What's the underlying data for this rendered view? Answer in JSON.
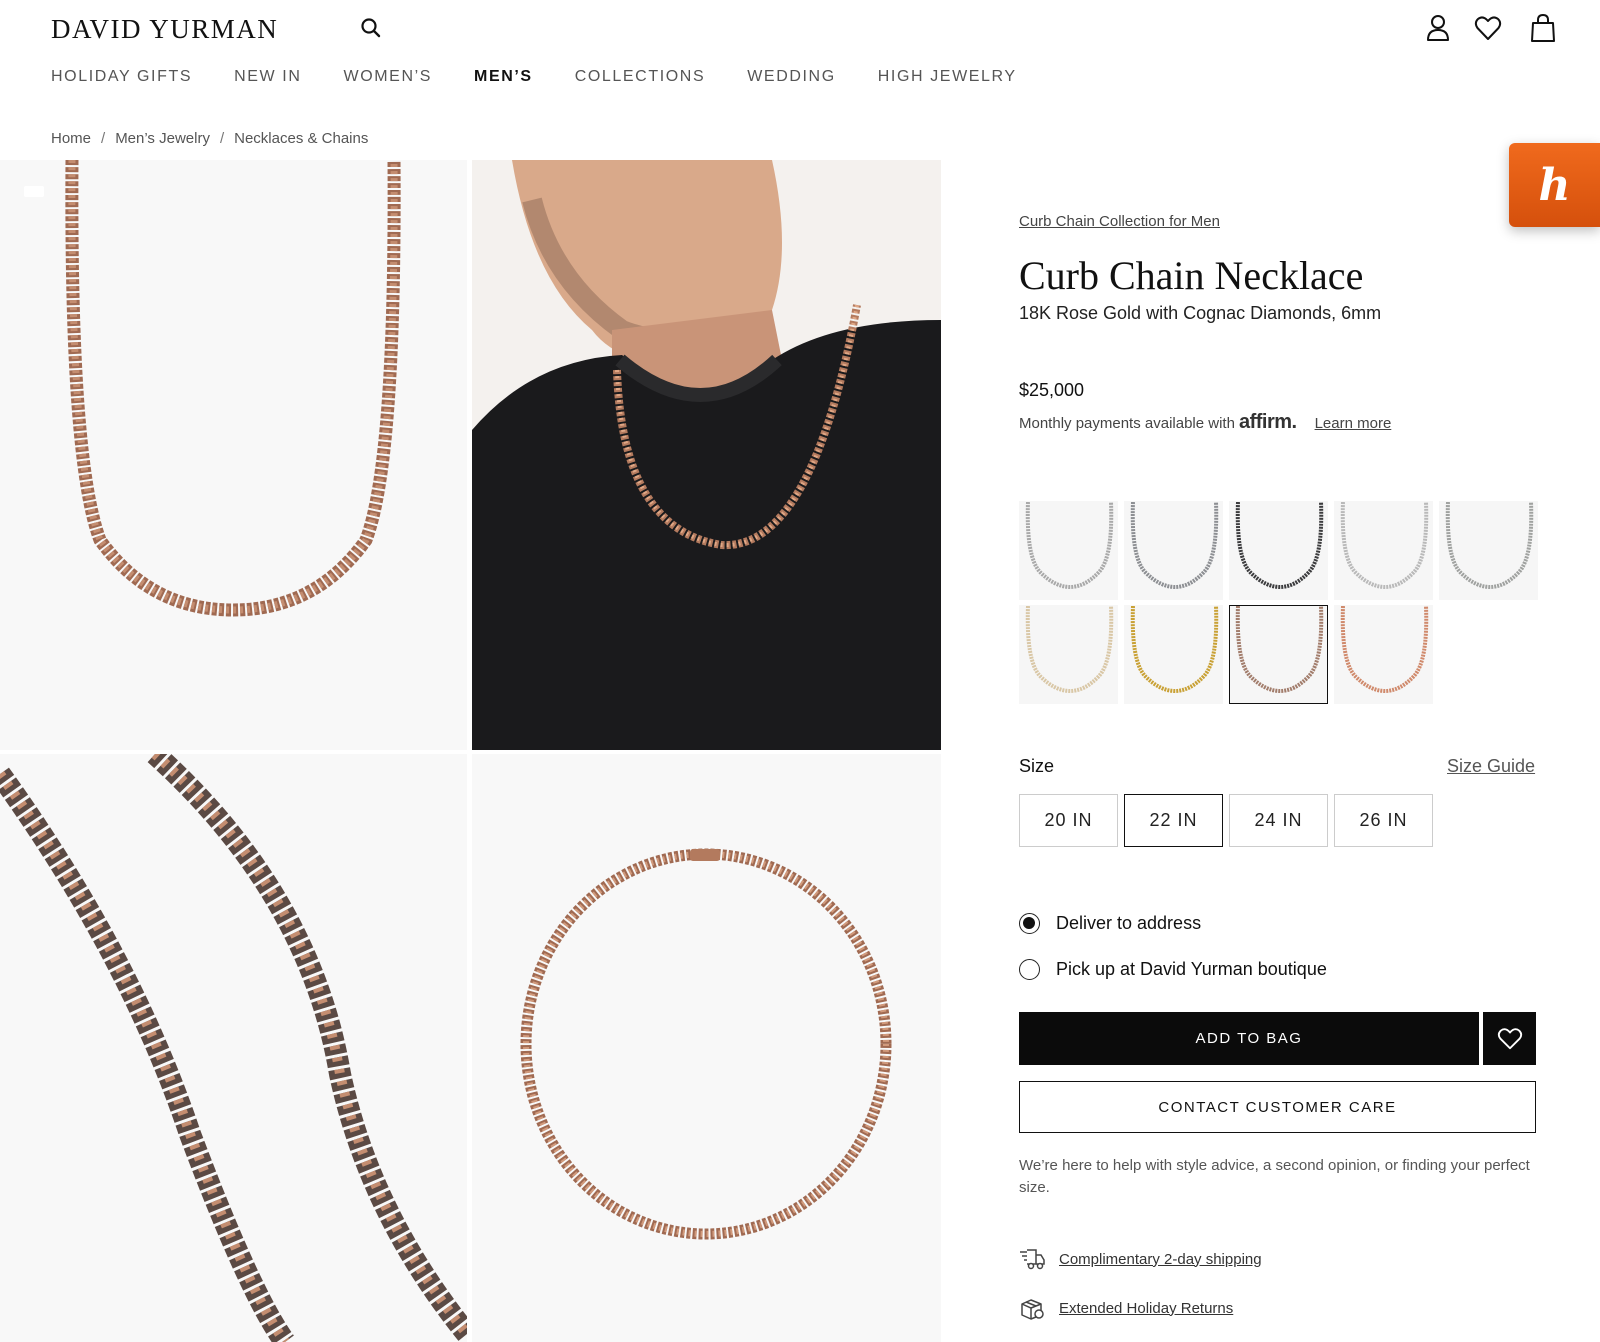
{
  "header": {
    "logo": "DAVID YURMAN",
    "icons": [
      "search-icon",
      "account-icon",
      "heart-icon",
      "shopping-bag-icon"
    ]
  },
  "nav": [
    {
      "label": "HOLIDAY GIFTS"
    },
    {
      "label": "NEW IN"
    },
    {
      "label": "WOMEN’S"
    },
    {
      "label": "MEN’S",
      "active": true
    },
    {
      "label": "COLLECTIONS"
    },
    {
      "label": "WEDDING"
    },
    {
      "label": "HIGH JEWELRY"
    }
  ],
  "breadcrumb": {
    "items": [
      "Home",
      "Men’s Jewelry",
      "Necklaces & Chains"
    ],
    "separator": "/"
  },
  "honey": {
    "letter": "h",
    "color": "#e8601a"
  },
  "product": {
    "collection": "Curb Chain Collection for Men",
    "title": "Curb Chain Necklace",
    "subtitle": "18K Rose Gold with Cognac Diamonds, 6mm",
    "price": "$25,000",
    "affirm": {
      "text": "Monthly payments available with",
      "logo": "affirm.",
      "learn_more": "Learn more"
    },
    "swatches": [
      {
        "name": "silver-chain",
        "color": "#a9a9a9",
        "selected": false
      },
      {
        "name": "silver-gray-chain",
        "color": "#8d8f93",
        "selected": false
      },
      {
        "name": "black-titanium-chain",
        "color": "#3c3c3e",
        "selected": false
      },
      {
        "name": "light-silver-chain",
        "color": "#b9b9b9",
        "selected": false
      },
      {
        "name": "silver-pave-chain",
        "color": "#a0a2a0",
        "selected": false
      },
      {
        "name": "diamond-pave-gold-chain",
        "color": "#d9c7a6",
        "selected": false
      },
      {
        "name": "yellow-gold-chain",
        "color": "#c9a135",
        "selected": false
      },
      {
        "name": "rose-gold-cognac-chain",
        "color": "#a27d6c",
        "selected": true
      },
      {
        "name": "rose-gold-chain",
        "color": "#d08a6c",
        "selected": false
      }
    ],
    "size": {
      "label": "Size",
      "guide": "Size Guide",
      "options": [
        {
          "label": "20 IN",
          "selected": false
        },
        {
          "label": "22 IN",
          "selected": true
        },
        {
          "label": "24 IN",
          "selected": false
        },
        {
          "label": "26 IN",
          "selected": false
        }
      ]
    },
    "delivery": [
      {
        "label": "Deliver to address",
        "checked": true
      },
      {
        "label": "Pick up at David Yurman boutique",
        "checked": false
      }
    ],
    "add_to_bag": "ADD TO BAG",
    "contact": "CONTACT CUSTOMER CARE",
    "help_text": "We’re here to help with style advice, a second opinion, or finding your perfect size.",
    "perks": [
      {
        "icon": "shipping-truck-icon",
        "label": "Complimentary 2-day shipping"
      },
      {
        "icon": "gift-box-icon",
        "label": "Extended Holiday Returns"
      }
    ]
  },
  "colors": {
    "chain_rose": "#b37a5e",
    "chain_dark": "#5b4a44",
    "sweater": "#1a1a1c",
    "skin": "#d9a98a"
  }
}
